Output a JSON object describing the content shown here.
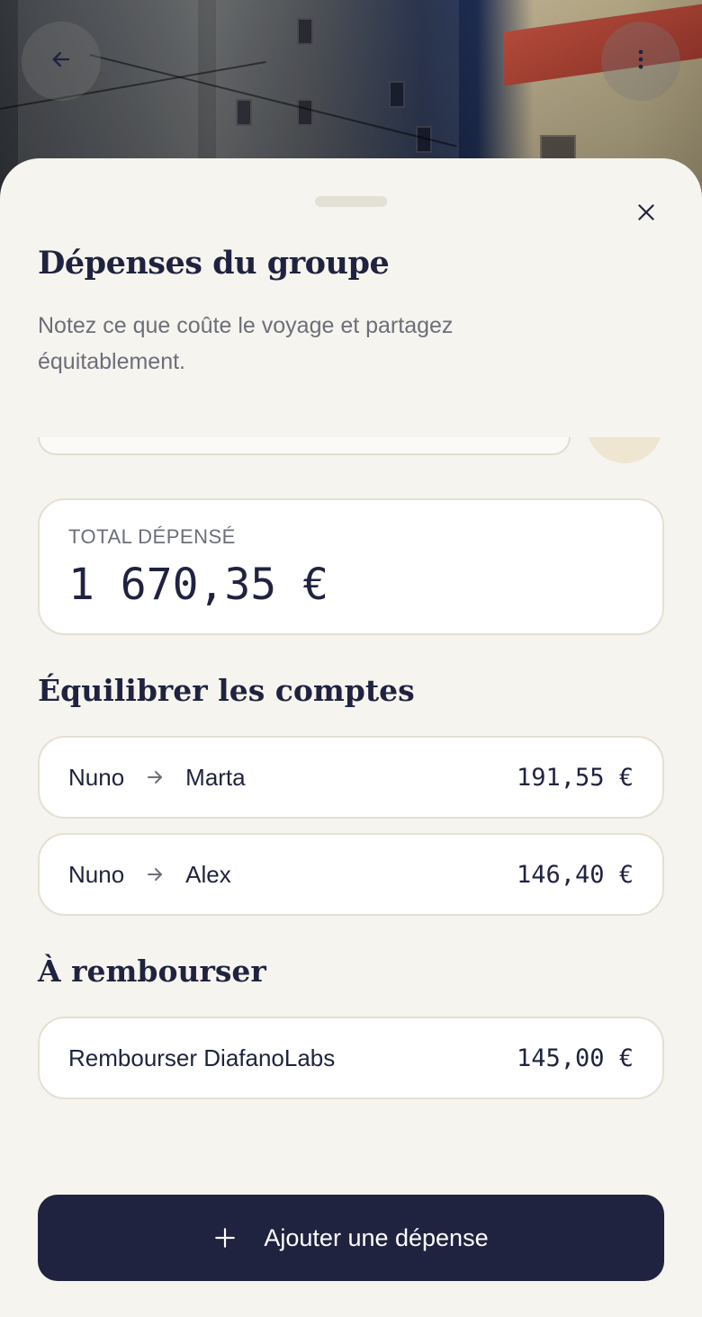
{
  "header": {
    "back_icon": "arrow-left-icon",
    "more_icon": "more-vertical-icon"
  },
  "sheet": {
    "close_icon": "close-icon",
    "title": "Dépenses du groupe",
    "subtitle": "Notez ce que coûte le voyage et partagez équitablement."
  },
  "total": {
    "label": "TOTAL DÉPENSÉ",
    "value": "1 670,35 €"
  },
  "balance": {
    "title": "Équilibrer les comptes",
    "rows": [
      {
        "from": "Nuno",
        "to": "Marta",
        "amount": "191,55 €"
      },
      {
        "from": "Nuno",
        "to": "Alex",
        "amount": "146,40 €"
      }
    ]
  },
  "reimburse": {
    "title": "À rembourser",
    "rows": [
      {
        "label": "Rembourser DiafanoLabs",
        "amount": "145,00 €"
      }
    ]
  },
  "add_button": {
    "label": "Ajouter une dépense",
    "icon": "plus-icon"
  },
  "colors": {
    "primary": "#1f2340",
    "sheet_bg": "#f6f4ee",
    "muted_text": "#6c6e7a",
    "card_border": "#e4e0d2"
  }
}
